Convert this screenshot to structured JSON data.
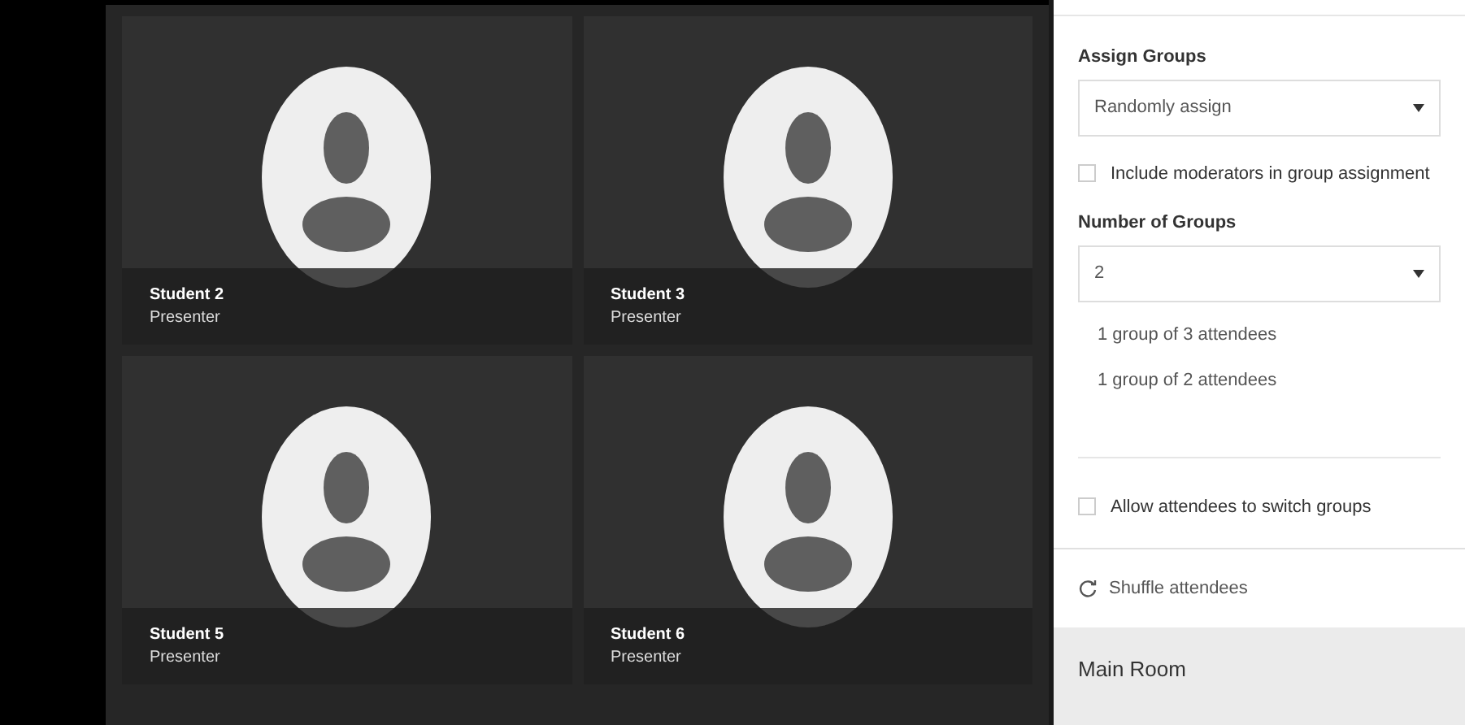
{
  "tiles": [
    {
      "name": "Student 2",
      "role": "Presenter"
    },
    {
      "name": "Student 3",
      "role": "Presenter"
    },
    {
      "name": "Student 5",
      "role": "Presenter"
    },
    {
      "name": "Student 6",
      "role": "Presenter"
    }
  ],
  "panel": {
    "assign_groups": {
      "label": "Assign Groups",
      "value": "Randomly assign"
    },
    "include_moderators": {
      "label": "Include moderators in group assignment",
      "checked": false
    },
    "number_of_groups": {
      "label": "Number of Groups",
      "value": "2"
    },
    "group_summary": [
      "1 group of 3 attendees",
      "1 group of 2 attendees"
    ],
    "allow_switch": {
      "label": "Allow attendees to switch groups",
      "checked": false
    },
    "shuffle": {
      "label": "Shuffle attendees"
    },
    "main_room": {
      "title": "Main Room"
    }
  }
}
